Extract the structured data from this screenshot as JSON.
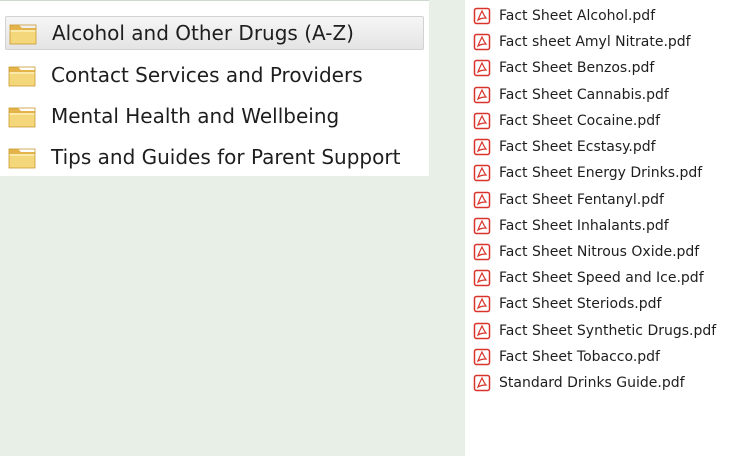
{
  "folders": {
    "items": [
      {
        "label": "Alcohol and Other Drugs (A-Z)",
        "selected": true
      },
      {
        "label": "Contact Services and Providers",
        "selected": false
      },
      {
        "label": "Mental Health and Wellbeing",
        "selected": false
      },
      {
        "label": "Tips and Guides for Parent Support",
        "selected": false
      }
    ],
    "icon": "folder-icon"
  },
  "files": {
    "icon": "pdf-icon",
    "items": [
      {
        "label": "Fact Sheet Alcohol.pdf"
      },
      {
        "label": "Fact sheet Amyl Nitrate.pdf"
      },
      {
        "label": "Fact Sheet Benzos.pdf"
      },
      {
        "label": "Fact Sheet Cannabis.pdf"
      },
      {
        "label": "Fact Sheet Cocaine.pdf"
      },
      {
        "label": "Fact Sheet Ecstasy.pdf"
      },
      {
        "label": "Fact Sheet Energy Drinks.pdf"
      },
      {
        "label": "Fact Sheet Fentanyl.pdf"
      },
      {
        "label": "Fact Sheet Inhalants.pdf"
      },
      {
        "label": "Fact Sheet Nitrous Oxide.pdf"
      },
      {
        "label": "Fact Sheet Speed and Ice.pdf"
      },
      {
        "label": "Fact Sheet Steriods.pdf"
      },
      {
        "label": "Fact Sheet Synthetic Drugs.pdf"
      },
      {
        "label": "Fact Sheet Tobacco.pdf"
      },
      {
        "label": "Standard Drinks Guide.pdf"
      }
    ]
  },
  "colors": {
    "background": "#e7efe6",
    "panel": "#ffffff",
    "folder": "#f0c75e",
    "pdf": "#d9342b"
  }
}
